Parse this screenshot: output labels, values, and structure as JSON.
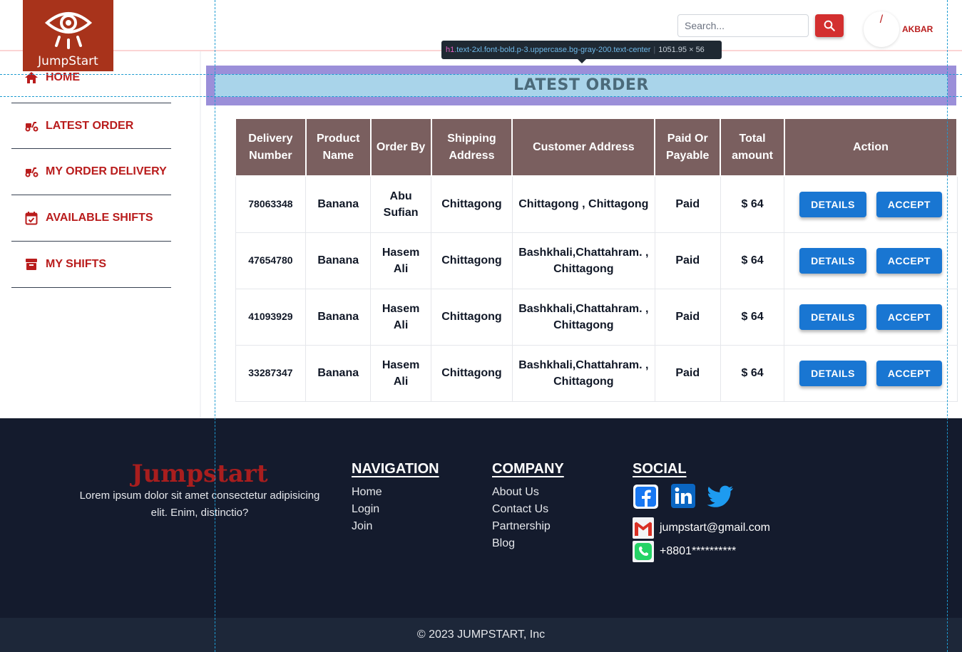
{
  "header": {
    "logo_text": "JumpStart",
    "search_placeholder": "Search...",
    "avatar_glyph": "/",
    "username": "AKBAR"
  },
  "sidebar": {
    "items": [
      {
        "label": "HOME",
        "icon": "home-icon"
      },
      {
        "label": "LATEST ORDER",
        "icon": "scooter-icon"
      },
      {
        "label": "MY ORDER DELIVERY",
        "icon": "scooter-icon"
      },
      {
        "label": "AVAILABLE SHIFTS",
        "icon": "calendar-check-icon"
      },
      {
        "label": "MY SHIFTS",
        "icon": "archive-icon"
      }
    ]
  },
  "devtools": {
    "tag": "h1",
    "classes": ".text-2xl.font-bold.p-3.uppercase.bg-gray-200.text-center",
    "size": "1051.95 × 56"
  },
  "main": {
    "title": "LATEST ORDER",
    "table": {
      "headers": [
        "Delivery Number",
        "Product Name",
        "Order By",
        "Shipping Address",
        "Customer Address",
        "Paid Or Payable",
        "Total amount",
        "Action"
      ],
      "rows": [
        {
          "delivery": "78063348",
          "product": "Banana",
          "order_by": "Abu Sufian",
          "shipping": "Chittagong",
          "customer": "Chittagong , Chittagong",
          "paid": "Paid",
          "total": "$ 64"
        },
        {
          "delivery": "47654780",
          "product": "Banana",
          "order_by": "Hasem Ali",
          "shipping": "Chittagong",
          "customer": "Bashkhali,Chattahram. , Chittagong",
          "paid": "Paid",
          "total": "$ 64"
        },
        {
          "delivery": "41093929",
          "product": "Banana",
          "order_by": "Hasem Ali",
          "shipping": "Chittagong",
          "customer": "Bashkhali,Chattahram. , Chittagong",
          "paid": "Paid",
          "total": "$ 64"
        },
        {
          "delivery": "33287347",
          "product": "Banana",
          "order_by": "Hasem Ali",
          "shipping": "Chittagong",
          "customer": "Bashkhali,Chattahram. , Chittagong",
          "paid": "Paid",
          "total": "$ 64"
        }
      ],
      "details_label": "DETAILS",
      "accept_label": "ACCEPT"
    }
  },
  "footer": {
    "brand": "Jumpstart",
    "description": "Lorem ipsum dolor sit amet consectetur adipisicing elit. Enim, distinctio?",
    "navigation": {
      "title": "NAVIGATION",
      "links": [
        "Home",
        "Login",
        "Join"
      ]
    },
    "company": {
      "title": "COMPANY",
      "links": [
        "About Us",
        "Contact Us",
        "Partnership",
        "Blog"
      ]
    },
    "social": {
      "title": "SOCIAL",
      "icons": [
        "facebook-icon",
        "linkedin-icon",
        "twitter-icon"
      ],
      "email": "jumpstart@gmail.com",
      "phone": "+8801**********"
    },
    "copyright": "© 2023 JUMPSTART, Inc"
  },
  "colors": {
    "brand_red": "#b91c1c",
    "logo_bg": "#a8331b",
    "table_header": "#7a5f5f",
    "button_blue": "#1976d2",
    "footer_bg": "#141b2d"
  }
}
